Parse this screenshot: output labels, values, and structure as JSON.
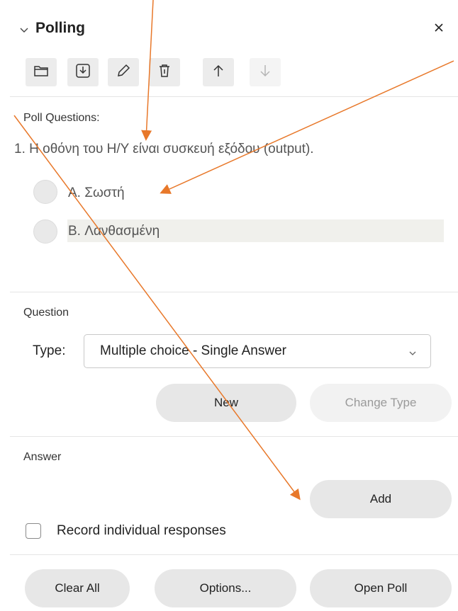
{
  "header": {
    "title": "Polling"
  },
  "sections": {
    "poll_questions": "Poll Questions:",
    "question": "Question",
    "answer": "Answer"
  },
  "poll": {
    "question_text": "1. Η οθόνη του Η/Υ είναι συσκευή εξόδου (output).",
    "answers": [
      {
        "label": "A. Σωστή"
      },
      {
        "label": "B. Λανθασμένη"
      }
    ]
  },
  "question": {
    "type_label": "Type:",
    "type_value": "Multiple choice - Single Answer",
    "new_button": "New",
    "change_type_button": "Change Type"
  },
  "answer": {
    "add_button": "Add",
    "record_label": "Record individual responses"
  },
  "footer": {
    "clear_all": "Clear All",
    "options": "Options...",
    "open_poll": "Open Poll"
  },
  "colors": {
    "annotation_arrow": "#e8782a"
  },
  "icons": [
    "chevron-down-icon",
    "close-icon",
    "folder-icon",
    "download-icon",
    "edit-icon",
    "trash-icon",
    "arrow-up-icon",
    "arrow-down-icon"
  ]
}
